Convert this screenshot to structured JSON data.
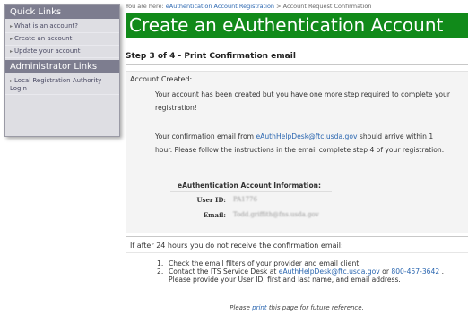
{
  "sidebar": {
    "quick_links_heading": "Quick Links",
    "quick_links": [
      {
        "label": "What is an account?"
      },
      {
        "label": "Create an account"
      },
      {
        "label": "Update your account"
      }
    ],
    "admin_heading": "Administrator Links",
    "admin_links": [
      {
        "label": "Local Registration Authority Login"
      }
    ]
  },
  "breadcrumb": {
    "prefix": "You are here:",
    "link": "eAuthentication Account Registration",
    "separator": ">",
    "current": "Account Request Confirmation"
  },
  "page_title": "Create an eAuthentication Account",
  "step_title": "Step 3 of 4 - Print Confirmation email",
  "account_created": {
    "heading": "Account Created:",
    "para1": "Your account has been created but you have one more step required to complete your registration!",
    "para2_prefix": "Your confirmation email from",
    "para2_email": "eAuthHelpDesk@ftc.usda.gov",
    "para2_suffix": "should arrive within 1 hour. Please follow the instructions in the email complete step 4 of your registration."
  },
  "account_info": {
    "title": "eAuthentication Account Information:",
    "user_id_label": "User ID:",
    "user_id_value": "PA1776",
    "email_label": "Email:",
    "email_value": "Todd.griffith@fns.usda.gov"
  },
  "no_email_section": {
    "heading": "If after 24 hours you do not receive the confirmation email:",
    "step1": "Check the email filters of your provider and email client.",
    "step2_prefix": "Contact the ITS Service Desk at",
    "step2_email": "eAuthHelpDesk@ftc.usda.gov",
    "step2_or": "or",
    "step2_phone": "800-457-3642",
    "step2_suffix": ". Please provide your User ID, first and last name, and email address."
  },
  "footer": {
    "prefix": "Please",
    "link": "print",
    "suffix": "this page for future reference."
  }
}
